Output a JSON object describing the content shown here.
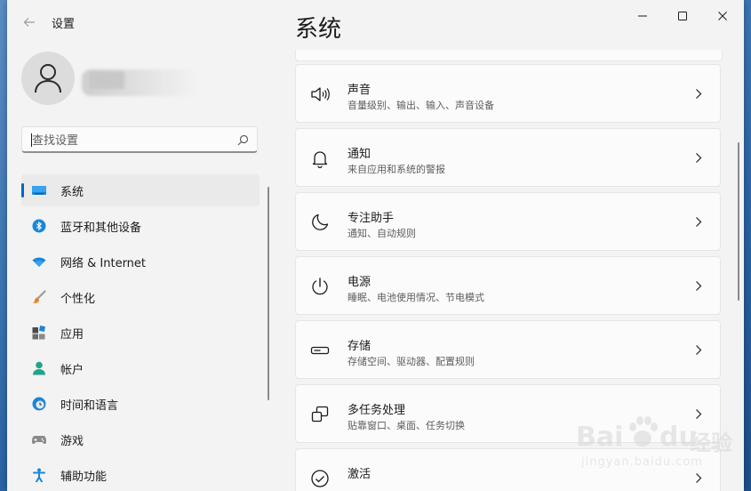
{
  "window": {
    "app_title": "设置",
    "back_icon": "back-arrow-icon",
    "controls": [
      "minimize-icon",
      "maximize-icon",
      "close-icon"
    ]
  },
  "sidebar": {
    "search": {
      "placeholder": "查找设置",
      "value": ""
    },
    "items": [
      {
        "label": "系统",
        "icon": "system-display-icon",
        "selected": true
      },
      {
        "label": "蓝牙和其他设备",
        "icon": "bluetooth-icon",
        "selected": false
      },
      {
        "label": "网络 & Internet",
        "icon": "wifi-icon",
        "selected": false
      },
      {
        "label": "个性化",
        "icon": "brush-icon",
        "selected": false
      },
      {
        "label": "应用",
        "icon": "apps-icon",
        "selected": false
      },
      {
        "label": "帐户",
        "icon": "account-icon",
        "selected": false
      },
      {
        "label": "时间和语言",
        "icon": "time-language-icon",
        "selected": false
      },
      {
        "label": "游戏",
        "icon": "gamepad-icon",
        "selected": false
      },
      {
        "label": "辅助功能",
        "icon": "accessibility-icon",
        "selected": false
      }
    ]
  },
  "main": {
    "title": "系统",
    "cards": [
      {
        "title": "声音",
        "subtitle": "音量级别、输出、输入、声音设备",
        "icon": "speaker-icon"
      },
      {
        "title": "通知",
        "subtitle": "来自应用和系统的警报",
        "icon": "bell-icon"
      },
      {
        "title": "专注助手",
        "subtitle": "通知、自动规则",
        "icon": "moon-icon"
      },
      {
        "title": "电源",
        "subtitle": "睡眠、电池使用情况、节电模式",
        "icon": "power-icon"
      },
      {
        "title": "存储",
        "subtitle": "存储空间、驱动器、配置规则",
        "icon": "storage-drive-icon"
      },
      {
        "title": "多任务处理",
        "subtitle": "贴靠窗口、桌面、任务切换",
        "icon": "multitask-icon"
      },
      {
        "title": "激活",
        "subtitle": "",
        "icon": "activation-check-icon"
      }
    ]
  },
  "watermark": {
    "brand": "Bai",
    "brand2": "du",
    "suffix": "经验",
    "url": "jingyan.baidu.com"
  },
  "colors": {
    "accent": "#0067c0",
    "background": "#f3f3f3",
    "card": "#fbfbfb"
  }
}
